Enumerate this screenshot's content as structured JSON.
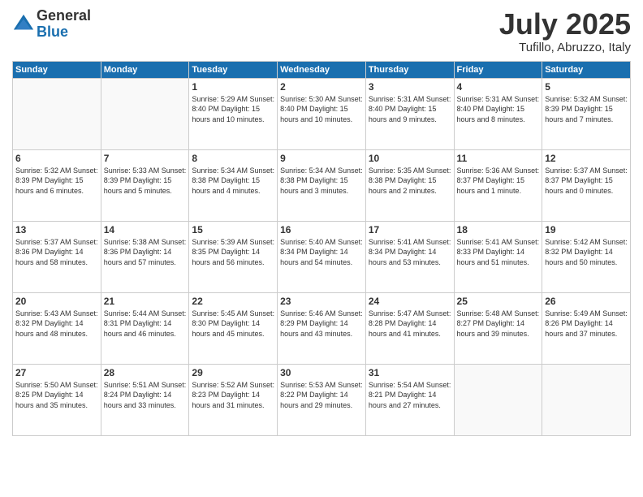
{
  "logo": {
    "general": "General",
    "blue": "Blue"
  },
  "title": "July 2025",
  "location": "Tufillo, Abruzzo, Italy",
  "days_header": [
    "Sunday",
    "Monday",
    "Tuesday",
    "Wednesday",
    "Thursday",
    "Friday",
    "Saturday"
  ],
  "weeks": [
    [
      {
        "day": "",
        "info": ""
      },
      {
        "day": "",
        "info": ""
      },
      {
        "day": "1",
        "info": "Sunrise: 5:29 AM\nSunset: 8:40 PM\nDaylight: 15 hours\nand 10 minutes."
      },
      {
        "day": "2",
        "info": "Sunrise: 5:30 AM\nSunset: 8:40 PM\nDaylight: 15 hours\nand 10 minutes."
      },
      {
        "day": "3",
        "info": "Sunrise: 5:31 AM\nSunset: 8:40 PM\nDaylight: 15 hours\nand 9 minutes."
      },
      {
        "day": "4",
        "info": "Sunrise: 5:31 AM\nSunset: 8:40 PM\nDaylight: 15 hours\nand 8 minutes."
      },
      {
        "day": "5",
        "info": "Sunrise: 5:32 AM\nSunset: 8:39 PM\nDaylight: 15 hours\nand 7 minutes."
      }
    ],
    [
      {
        "day": "6",
        "info": "Sunrise: 5:32 AM\nSunset: 8:39 PM\nDaylight: 15 hours\nand 6 minutes."
      },
      {
        "day": "7",
        "info": "Sunrise: 5:33 AM\nSunset: 8:39 PM\nDaylight: 15 hours\nand 5 minutes."
      },
      {
        "day": "8",
        "info": "Sunrise: 5:34 AM\nSunset: 8:38 PM\nDaylight: 15 hours\nand 4 minutes."
      },
      {
        "day": "9",
        "info": "Sunrise: 5:34 AM\nSunset: 8:38 PM\nDaylight: 15 hours\nand 3 minutes."
      },
      {
        "day": "10",
        "info": "Sunrise: 5:35 AM\nSunset: 8:38 PM\nDaylight: 15 hours\nand 2 minutes."
      },
      {
        "day": "11",
        "info": "Sunrise: 5:36 AM\nSunset: 8:37 PM\nDaylight: 15 hours\nand 1 minute."
      },
      {
        "day": "12",
        "info": "Sunrise: 5:37 AM\nSunset: 8:37 PM\nDaylight: 15 hours\nand 0 minutes."
      }
    ],
    [
      {
        "day": "13",
        "info": "Sunrise: 5:37 AM\nSunset: 8:36 PM\nDaylight: 14 hours\nand 58 minutes."
      },
      {
        "day": "14",
        "info": "Sunrise: 5:38 AM\nSunset: 8:36 PM\nDaylight: 14 hours\nand 57 minutes."
      },
      {
        "day": "15",
        "info": "Sunrise: 5:39 AM\nSunset: 8:35 PM\nDaylight: 14 hours\nand 56 minutes."
      },
      {
        "day": "16",
        "info": "Sunrise: 5:40 AM\nSunset: 8:34 PM\nDaylight: 14 hours\nand 54 minutes."
      },
      {
        "day": "17",
        "info": "Sunrise: 5:41 AM\nSunset: 8:34 PM\nDaylight: 14 hours\nand 53 minutes."
      },
      {
        "day": "18",
        "info": "Sunrise: 5:41 AM\nSunset: 8:33 PM\nDaylight: 14 hours\nand 51 minutes."
      },
      {
        "day": "19",
        "info": "Sunrise: 5:42 AM\nSunset: 8:32 PM\nDaylight: 14 hours\nand 50 minutes."
      }
    ],
    [
      {
        "day": "20",
        "info": "Sunrise: 5:43 AM\nSunset: 8:32 PM\nDaylight: 14 hours\nand 48 minutes."
      },
      {
        "day": "21",
        "info": "Sunrise: 5:44 AM\nSunset: 8:31 PM\nDaylight: 14 hours\nand 46 minutes."
      },
      {
        "day": "22",
        "info": "Sunrise: 5:45 AM\nSunset: 8:30 PM\nDaylight: 14 hours\nand 45 minutes."
      },
      {
        "day": "23",
        "info": "Sunrise: 5:46 AM\nSunset: 8:29 PM\nDaylight: 14 hours\nand 43 minutes."
      },
      {
        "day": "24",
        "info": "Sunrise: 5:47 AM\nSunset: 8:28 PM\nDaylight: 14 hours\nand 41 minutes."
      },
      {
        "day": "25",
        "info": "Sunrise: 5:48 AM\nSunset: 8:27 PM\nDaylight: 14 hours\nand 39 minutes."
      },
      {
        "day": "26",
        "info": "Sunrise: 5:49 AM\nSunset: 8:26 PM\nDaylight: 14 hours\nand 37 minutes."
      }
    ],
    [
      {
        "day": "27",
        "info": "Sunrise: 5:50 AM\nSunset: 8:25 PM\nDaylight: 14 hours\nand 35 minutes."
      },
      {
        "day": "28",
        "info": "Sunrise: 5:51 AM\nSunset: 8:24 PM\nDaylight: 14 hours\nand 33 minutes."
      },
      {
        "day": "29",
        "info": "Sunrise: 5:52 AM\nSunset: 8:23 PM\nDaylight: 14 hours\nand 31 minutes."
      },
      {
        "day": "30",
        "info": "Sunrise: 5:53 AM\nSunset: 8:22 PM\nDaylight: 14 hours\nand 29 minutes."
      },
      {
        "day": "31",
        "info": "Sunrise: 5:54 AM\nSunset: 8:21 PM\nDaylight: 14 hours\nand 27 minutes."
      },
      {
        "day": "",
        "info": ""
      },
      {
        "day": "",
        "info": ""
      }
    ]
  ]
}
